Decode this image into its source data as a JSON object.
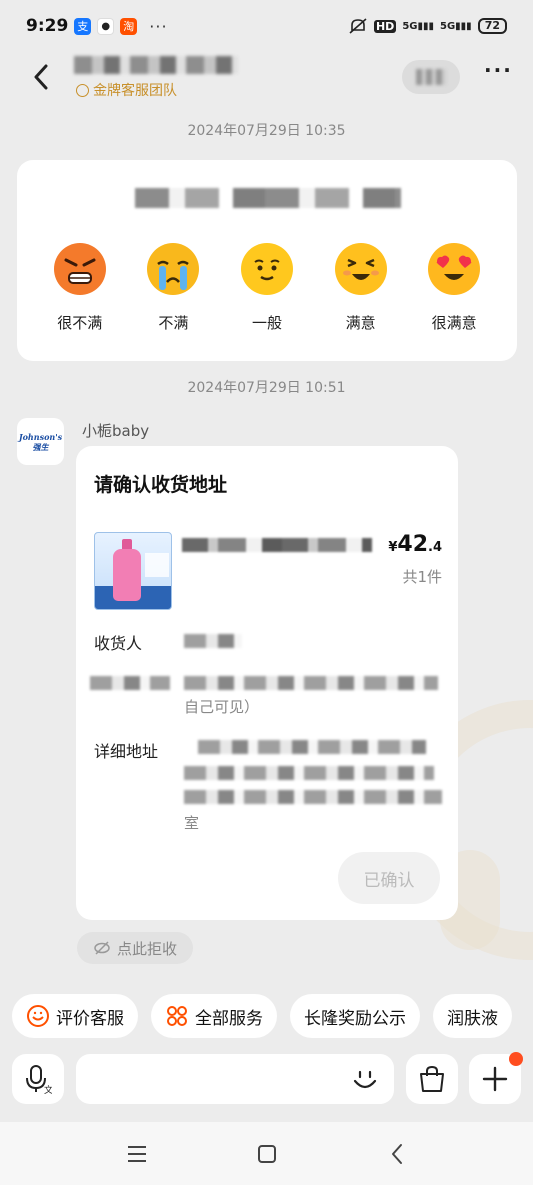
{
  "status_bar": {
    "time": "9:29",
    "app_icons": [
      {
        "name": "alipay-icon",
        "color": "#1677ff",
        "glyph": "支"
      },
      {
        "name": "qq-icon",
        "color": "#ffffff",
        "glyph": "🐧"
      },
      {
        "name": "taobao-icon",
        "color": "#ff5000",
        "glyph": "淘"
      }
    ],
    "more": "···",
    "signal1": "5G",
    "signal2": "5G",
    "hd": "HD",
    "battery": "72"
  },
  "header": {
    "team_label": "金牌客服团队",
    "more": "···"
  },
  "timestamps": {
    "first": "2024年07月29日 10:35",
    "second": "2024年07月29日 10:51"
  },
  "rating_card": {
    "options": [
      {
        "label": "很不满",
        "icon": "angry-face-icon",
        "color": "#f57d2a"
      },
      {
        "label": "不满",
        "icon": "crying-face-icon",
        "color": "#f7b21c"
      },
      {
        "label": "一般",
        "icon": "neutral-face-icon",
        "color": "#ffc71c"
      },
      {
        "label": "满意",
        "icon": "happy-face-icon",
        "color": "#ffbf1c"
      },
      {
        "label": "很满意",
        "icon": "heart-eyes-face-icon",
        "color": "#ffb31c"
      }
    ]
  },
  "bot": {
    "avatar_text": "Johnson's 强生",
    "name": "小栀baby"
  },
  "address_card": {
    "title": "请确认收货地址",
    "price_symbol": "¥",
    "price_int": "42",
    "price_dec": ".4",
    "quantity": "共1件",
    "recipient_label": "收货人",
    "phone_suffix": "自己可见）",
    "detail_label": "详细地址",
    "detail_suffix": "室",
    "confirm_label": "已确认"
  },
  "reject": {
    "label": "点此拒收"
  },
  "quick_actions": [
    {
      "label": "评价客服",
      "icon": "smile-icon"
    },
    {
      "label": "全部服务",
      "icon": "grid-icon"
    },
    {
      "label": "长隆奖励公示",
      "icon": ""
    },
    {
      "label": "润肤液",
      "icon": ""
    }
  ],
  "colors": {
    "accent": "#ff5000",
    "gold": "#c8902a",
    "background": "#ececec"
  }
}
